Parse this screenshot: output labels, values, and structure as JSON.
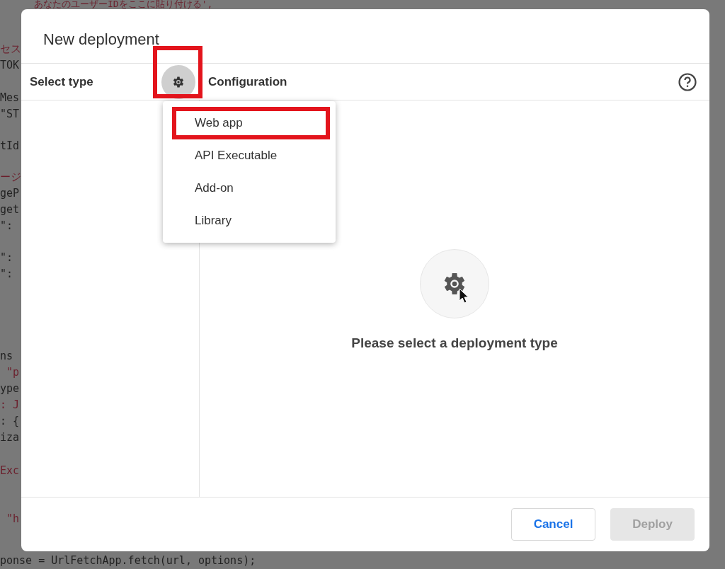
{
  "background_code": {
    "groups": [
      [
        "あなたのユーザーIDをここに貼り付ける',"
      ],
      [
        "セス",
        "TOK"
      ],
      [
        "Mes",
        "\"ST"
      ],
      [
        "tId"
      ],
      [
        "ージ",
        "geP",
        "get",
        "\":"
      ],
      [
        "\":",
        "\":"
      ],
      [
        "ns",
        " \"p",
        "ype",
        ": J",
        ": {",
        "iza"
      ],
      [
        "Exc"
      ],
      [
        " \"h"
      ],
      [
        "ponse = UrlFetchApp.fetch(url, options);"
      ]
    ]
  },
  "dialog": {
    "title": "New deployment",
    "select_type_label": "Select type",
    "type_button": {
      "annotated": true
    },
    "configuration_label": "Configuration",
    "menu": {
      "items": [
        {
          "label": "Web app",
          "annotated": true
        },
        {
          "label": "API Executable",
          "annotated": false
        },
        {
          "label": "Add-on",
          "annotated": false
        },
        {
          "label": "Library",
          "annotated": false
        }
      ]
    },
    "empty_message": "Please select a deployment type",
    "buttons": [
      {
        "label": "Cancel",
        "disabled": false
      },
      {
        "label": "Deploy",
        "disabled": true
      }
    ]
  }
}
